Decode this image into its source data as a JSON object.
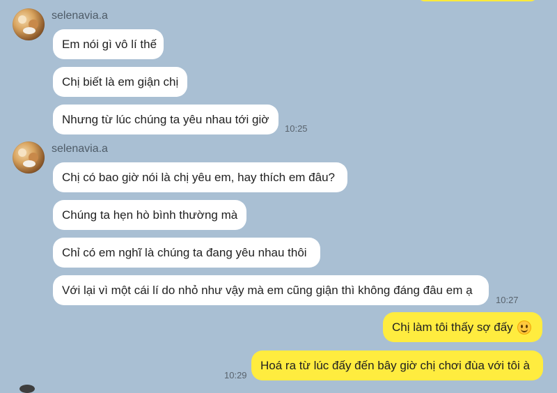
{
  "conversation": {
    "group1": {
      "sender": "selenavia.a",
      "messages": [
        "Em nói gì vô lí thế",
        "Chị biết là em giận chị",
        "Nhưng từ lúc chúng ta yêu nhau tới giờ"
      ],
      "time": "10:25"
    },
    "group2": {
      "sender": "selenavia.a",
      "messages": [
        "Chị có bao giờ nói là chị yêu em, hay thích em đâu?",
        "Chúng ta hẹn hò bình thường mà",
        "Chỉ có em nghĩ là chúng ta đang yêu nhau thôi",
        "Với lại vì một cái lí do nhỏ như vậy mà em cũng giận thì không đáng đâu em ạ"
      ],
      "time": "10:27"
    },
    "outgoing": {
      "messages": [
        "Chị làm tôi thấy sợ đấy",
        "Hoá ra từ lúc đấy đến bây giờ chị chơi đùa với tôi à"
      ],
      "time": "10:29"
    }
  },
  "icons": {
    "emoji": "grinning-face-icon",
    "avatar": "profile-avatar-icon"
  },
  "colors": {
    "background": "#a9bfd3",
    "incoming_bubble": "#ffffff",
    "outgoing_bubble": "#ffec3f",
    "timestamp": "#59636d"
  }
}
